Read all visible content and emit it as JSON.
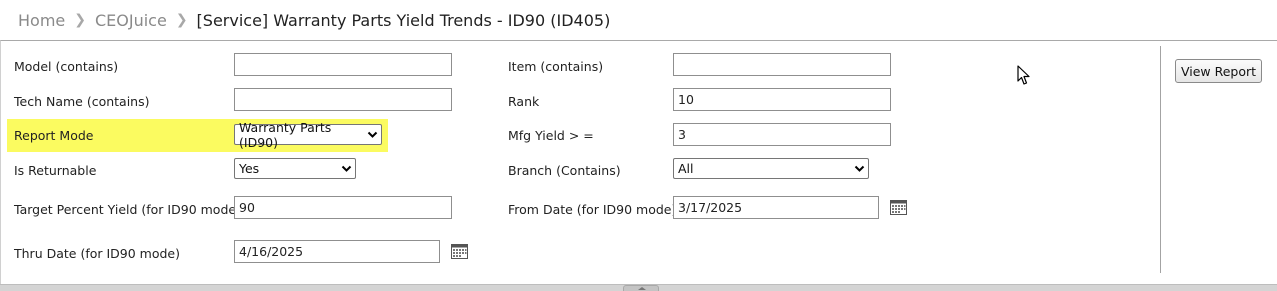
{
  "breadcrumb": {
    "items": [
      "Home",
      "CEOJuice"
    ],
    "current": "[Service] Warranty Parts Yield Trends - ID90 (ID405)"
  },
  "form": {
    "model": {
      "label": "Model (contains)",
      "value": ""
    },
    "item": {
      "label": "Item (contains)",
      "value": ""
    },
    "tech_name": {
      "label": "Tech Name (contains)",
      "value": ""
    },
    "rank": {
      "label": "Rank",
      "value": "10"
    },
    "report_mode": {
      "label": "Report Mode",
      "value": "Warranty Parts (ID90)",
      "highlight_color": "#fbfb60"
    },
    "mfg_yield": {
      "label": "Mfg Yield > =",
      "value": "3"
    },
    "is_returnable": {
      "label": "Is Returnable",
      "value": "Yes"
    },
    "branch": {
      "label": "Branch (Contains)",
      "value": "All"
    },
    "target_percent_yield": {
      "label": "Target Percent Yield (for ID90 mode)",
      "value": "90"
    },
    "from_date": {
      "label": "From Date (for ID90 mode)",
      "value": "3/17/2025",
      "icon": "calendar-icon"
    },
    "thru_date": {
      "label": "Thru Date (for ID90 mode)",
      "value": "4/16/2025",
      "icon": "calendar-icon"
    }
  },
  "actions": {
    "view_report": "View Report"
  }
}
